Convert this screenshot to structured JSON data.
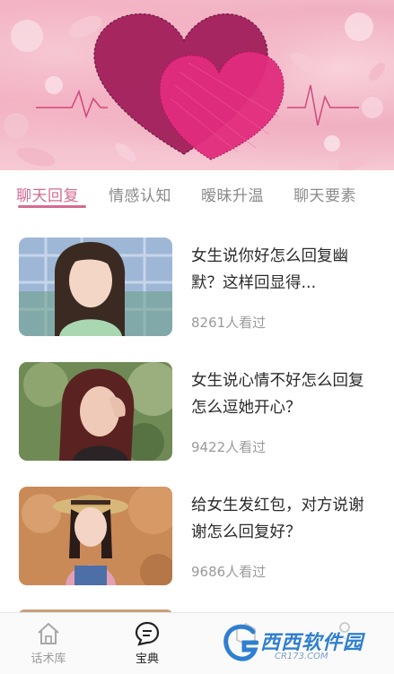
{
  "tabs": [
    {
      "label": "聊天回复",
      "active": true
    },
    {
      "label": "情感认知",
      "active": false
    },
    {
      "label": "暧昧升温",
      "active": false
    },
    {
      "label": "聊天要素",
      "active": false
    }
  ],
  "articles": [
    {
      "title": "女生说你好怎么回复幽默？这样回显得...",
      "views": "8261人看过"
    },
    {
      "title": "女生说心情不好怎么回复怎么逗她开心？",
      "views": "9422人看过"
    },
    {
      "title": "给女生发红包，对方说谢谢怎么回复好？",
      "views": "9686人看过"
    }
  ],
  "nav": {
    "home_label": "话术库",
    "treasure_label": "宝典"
  },
  "watermark": {
    "text": "西西软件园",
    "sub": "CR173.COM"
  },
  "colors": {
    "accent": "#d46a92",
    "banner_pink": "#f2b6c6",
    "heart_dark": "#a3195b",
    "heart_light": "#e0287a"
  }
}
